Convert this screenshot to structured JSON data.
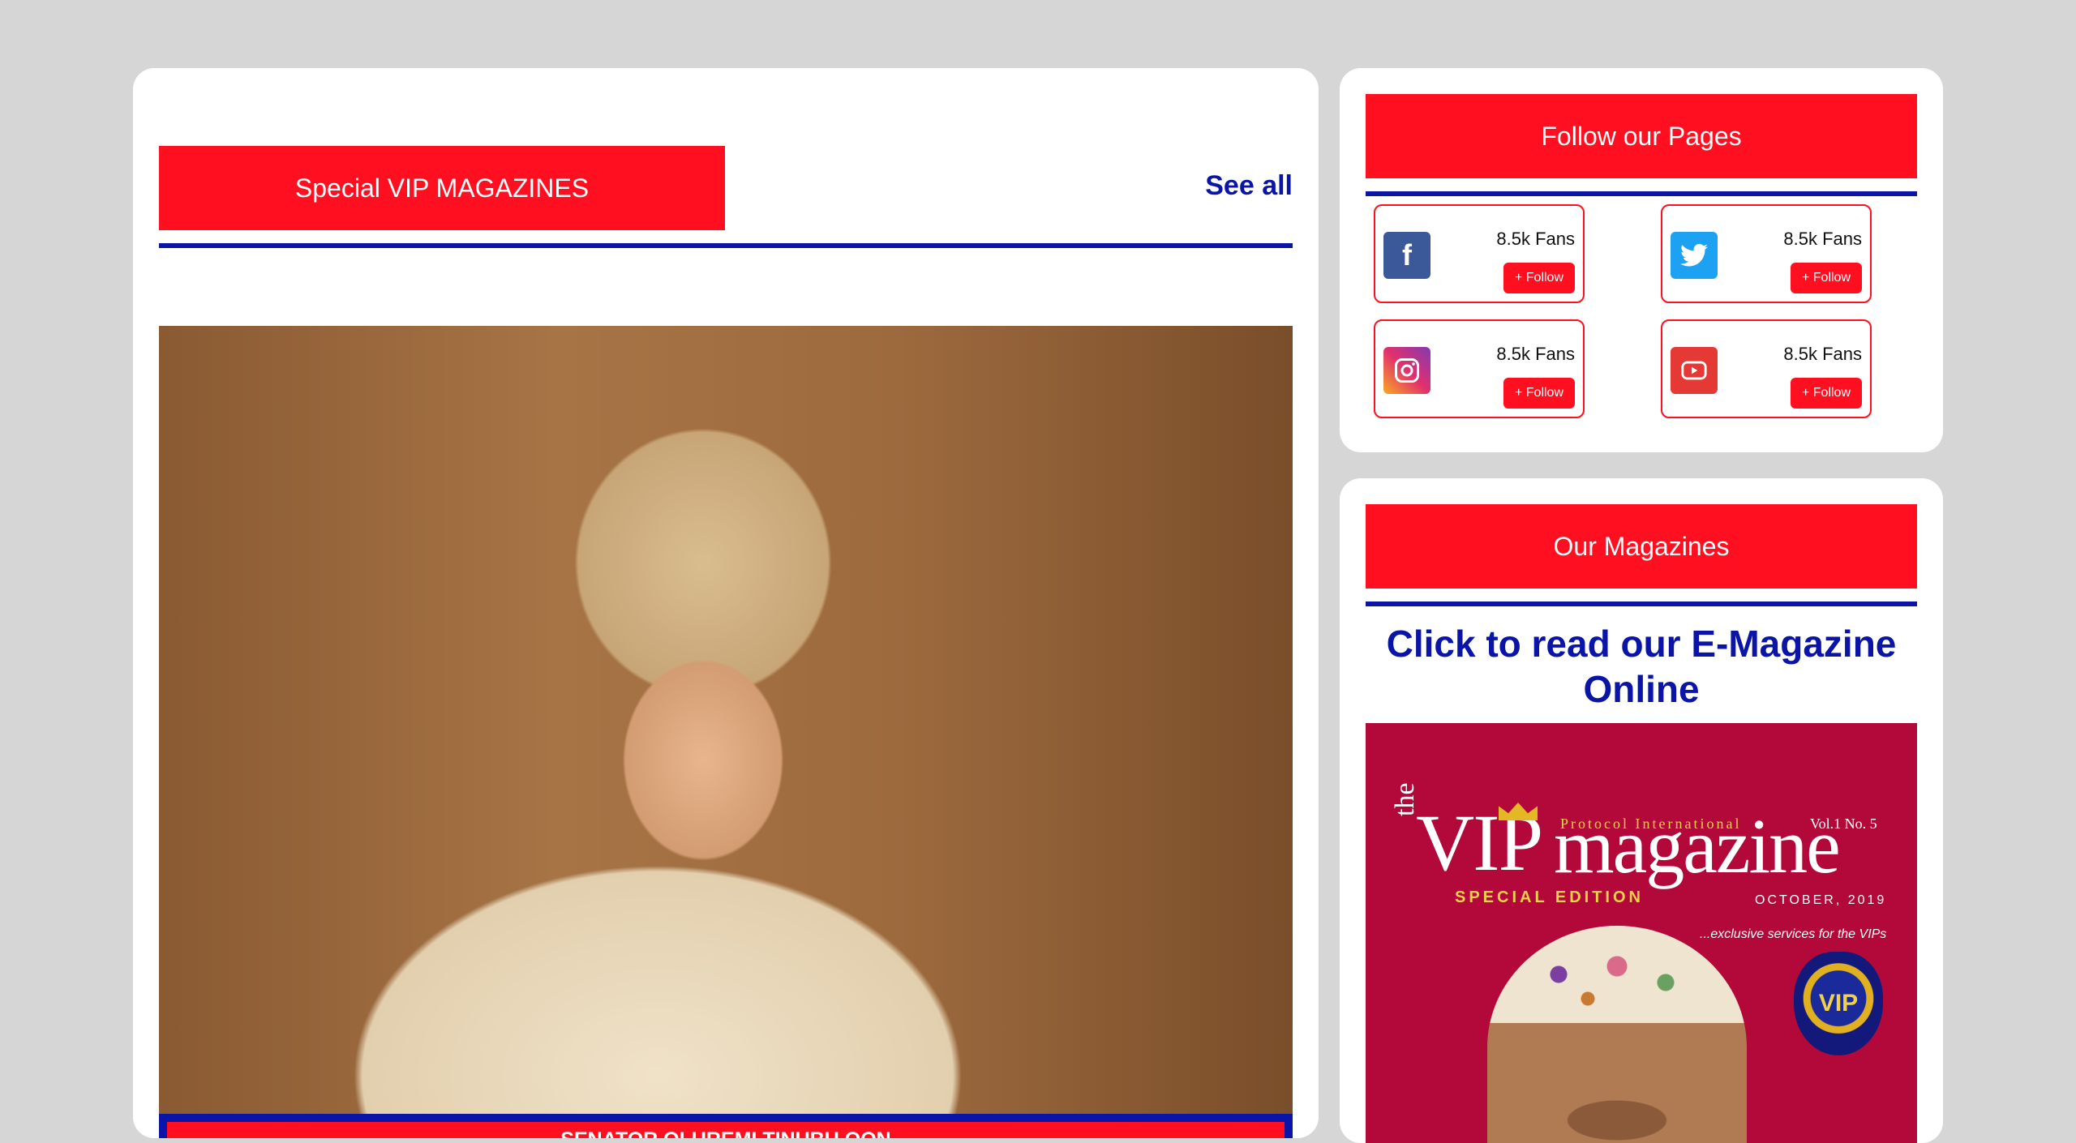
{
  "left_section": {
    "title": "Special VIP MAGAZINES",
    "see_all": "See all",
    "featured_caption": "SENATOR OLUREMI TINUBU OON"
  },
  "follow": {
    "title": "Follow our Pages",
    "items": [
      {
        "network": "facebook",
        "icon": "facebook-icon",
        "color": "#3b5998",
        "fans": "8.5k Fans",
        "button": "+ Follow"
      },
      {
        "network": "twitter",
        "icon": "twitter-icon",
        "color": "#1da1f2",
        "fans": "8.5k Fans",
        "button": "+ Follow"
      },
      {
        "network": "instagram",
        "icon": "instagram-icon",
        "color": "#e1306c",
        "fans": "8.5k Fans",
        "button": "+ Follow"
      },
      {
        "network": "youtube",
        "icon": "youtube-icon",
        "color": "#e53935",
        "fans": "8.5k Fans",
        "button": "+ Follow"
      }
    ]
  },
  "magazines": {
    "title": "Our Magazines",
    "link_text": "Click to read our E-Magazine Online",
    "cover": {
      "the": "the",
      "vip": "VIP",
      "word": "magazine",
      "protocol": "Protocol International",
      "vol": "Vol.1 No. 5",
      "special": "SPECIAL EDITION",
      "date": "OCTOBER, 2019",
      "tagline": "...exclusive services for the VIPs",
      "badge": "VIP"
    }
  },
  "colors": {
    "accent_red": "#ff0f1f",
    "accent_blue": "#0a15a8",
    "background": "#d6d6d6"
  }
}
